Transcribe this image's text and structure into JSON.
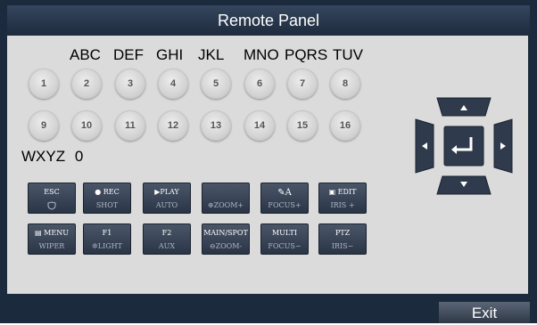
{
  "window": {
    "title": "Remote Panel"
  },
  "letters": [
    "ABC",
    "DEF",
    "GHI",
    "JKL",
    "MNO",
    "PQRS",
    "TUV"
  ],
  "keys_row1": [
    "1",
    "2",
    "3",
    "4",
    "5",
    "6",
    "7",
    "8"
  ],
  "keys_row2": [
    "9",
    "10",
    "11",
    "12",
    "13",
    "14",
    "15",
    "16"
  ],
  "bottom_letters": {
    "wxyz": "WXYZ",
    "zero": "0"
  },
  "function_rows": [
    [
      {
        "line1": "ESC",
        "line2": ""
      },
      {
        "line1": "● REC",
        "line2": "SHOT"
      },
      {
        "line1": "▶PLAY",
        "line2": "AUTO"
      },
      {
        "line1": "",
        "line2": "ZOOM+"
      },
      {
        "line1": "",
        "line2": "FOCUS+"
      },
      {
        "line1": "EDIT",
        "line2": "IRIS +"
      }
    ],
    [
      {
        "line1": "MENU",
        "line2": "WIPER"
      },
      {
        "line1": "F1",
        "line2": "LIGHT"
      },
      {
        "line1": "F2",
        "line2": "AUX"
      },
      {
        "line1": "MAIN/SPOT",
        "line2": "ZOOM-"
      },
      {
        "line1": "MULTI",
        "line2": "FOCUS−"
      },
      {
        "line1": "PTZ",
        "line2": "IRIS−"
      }
    ]
  ],
  "footer": {
    "exit_label": "Exit"
  }
}
